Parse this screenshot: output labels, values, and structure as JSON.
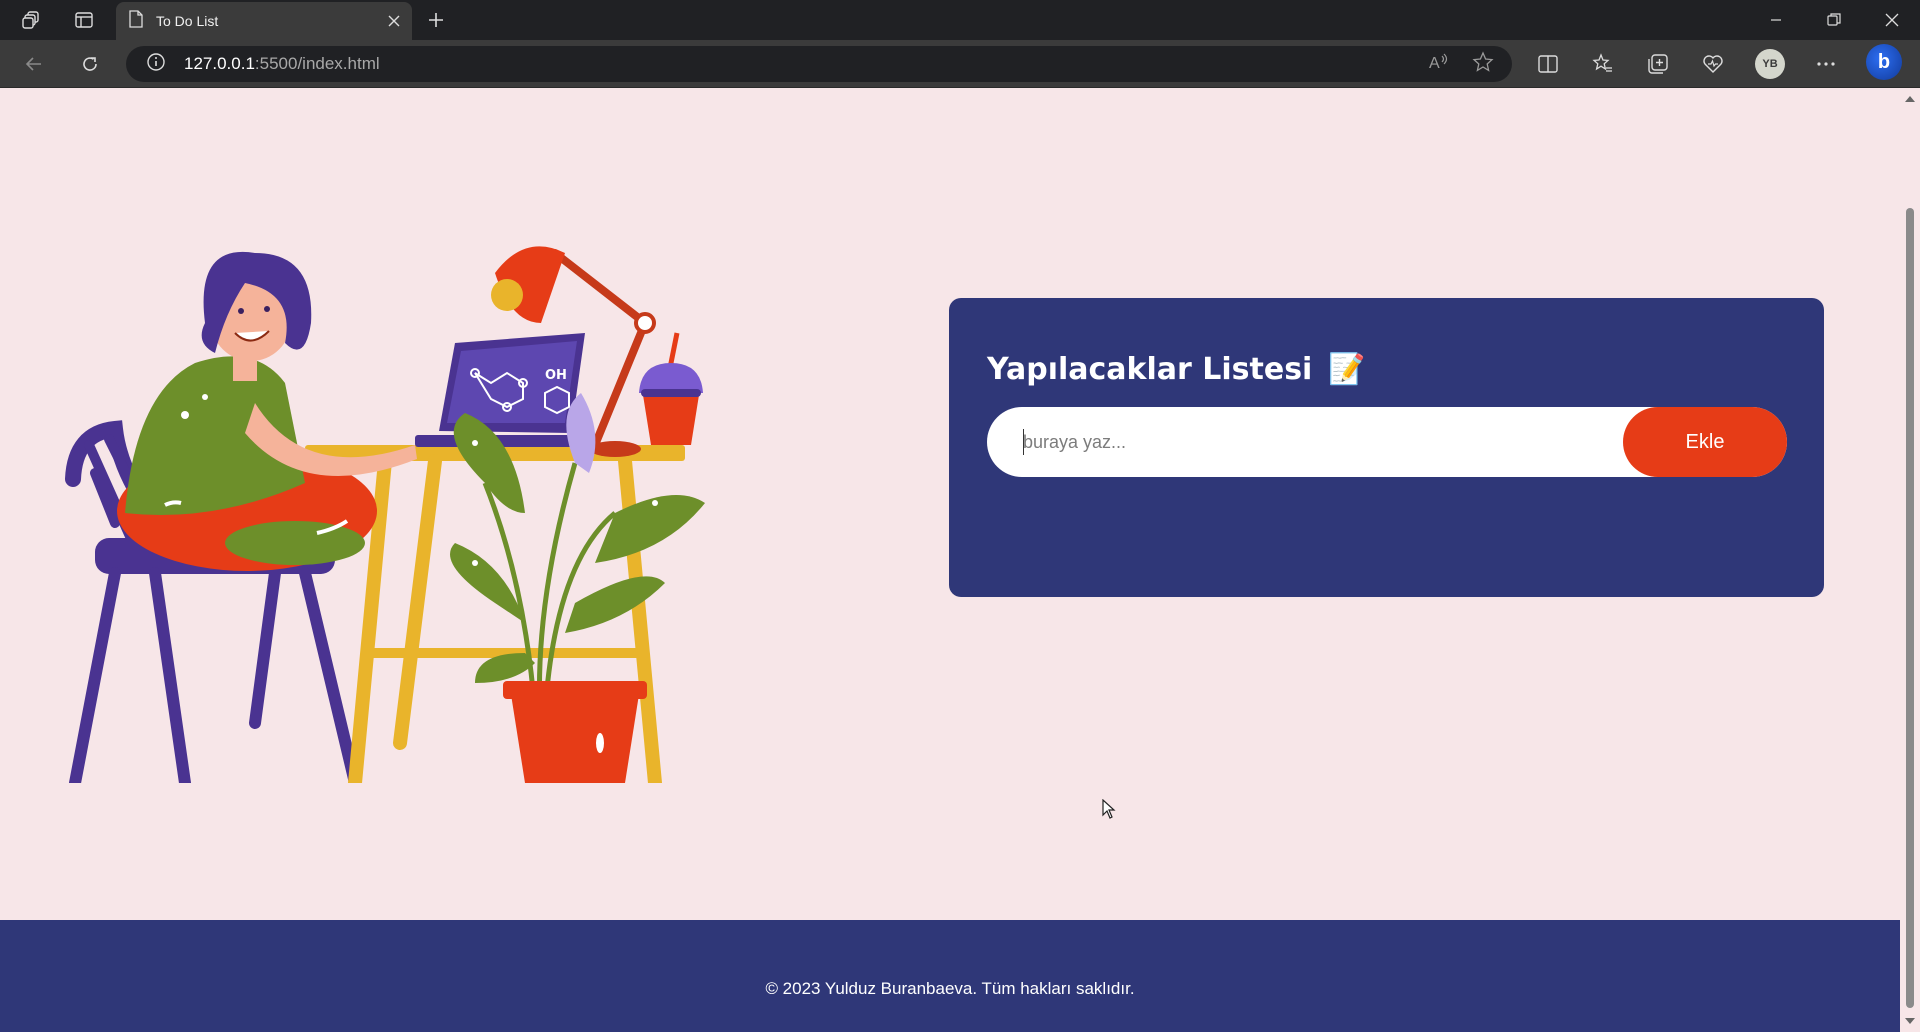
{
  "browser": {
    "tab_title": "To Do List",
    "url_host": "127.0.0.1",
    "url_path": ":5500/index.html",
    "profile_initials": "YB"
  },
  "card": {
    "title": "Yapılacaklar Listesi",
    "title_emoji": "📝",
    "input_placeholder": "buraya yaz...",
    "add_button_label": "Ekle"
  },
  "footer": {
    "copyright": "© 2023 Yulduz Buranbaeva. Tüm hakları saklıdır."
  },
  "colors": {
    "page_bg": "#f7e6e8",
    "card_bg": "#2f3778",
    "accent": "#e63c17",
    "footer_bg": "#2f3778"
  }
}
